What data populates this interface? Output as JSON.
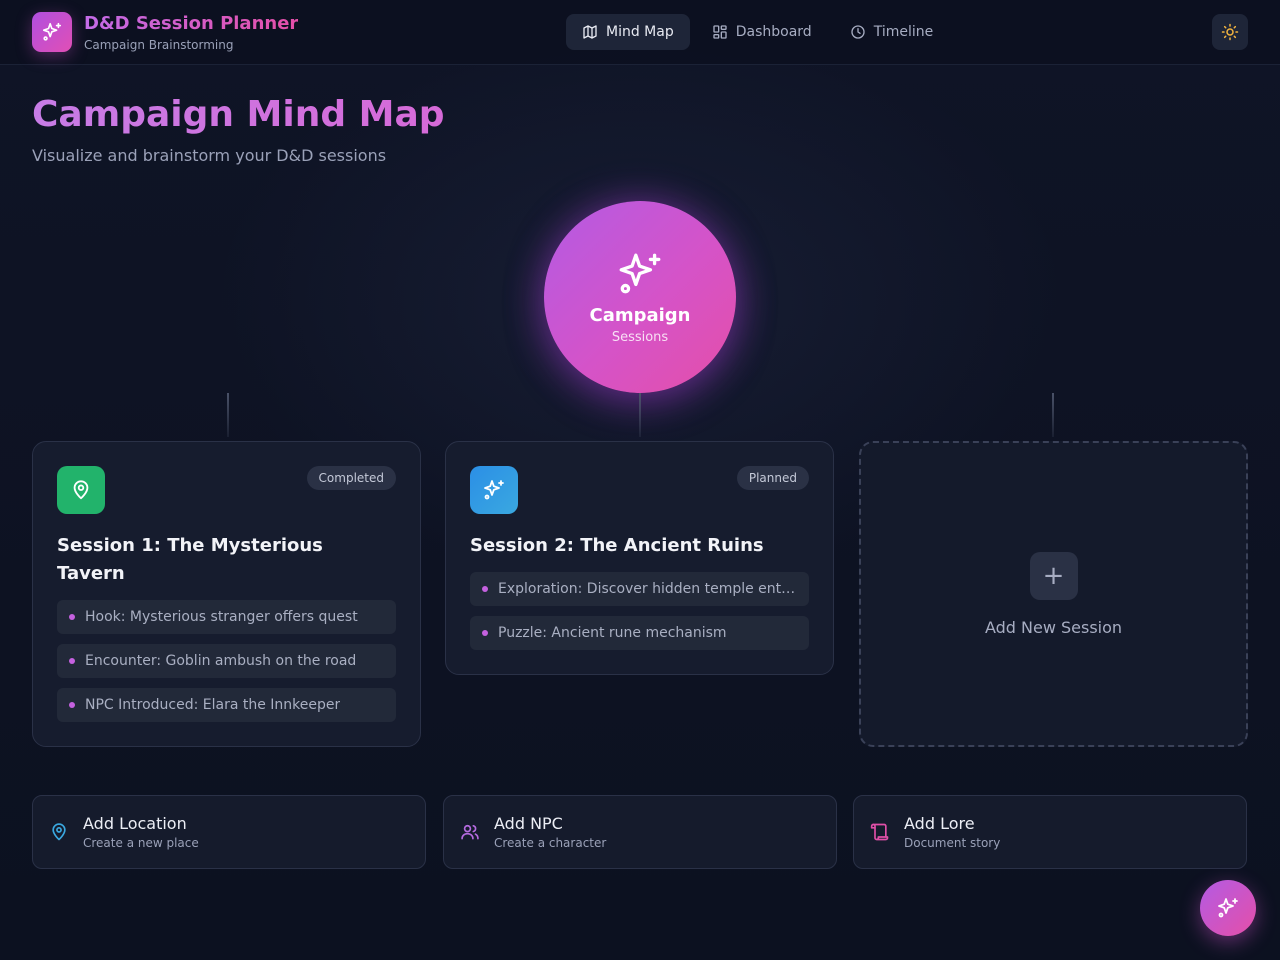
{
  "app": {
    "title": "D&D Session Planner",
    "subtitle": "Campaign Brainstorming",
    "logo_icon": "sparkles-icon"
  },
  "nav": {
    "items": [
      {
        "label": "Mind Map",
        "icon": "map-icon",
        "active": true
      },
      {
        "label": "Dashboard",
        "icon": "dashboard-icon",
        "active": false
      },
      {
        "label": "Timeline",
        "icon": "clock-icon",
        "active": false
      }
    ],
    "theme_toggle_icon": "sun-icon"
  },
  "page": {
    "title": "Campaign Mind Map",
    "subtitle": "Visualize and brainstorm your D&D sessions"
  },
  "center_node": {
    "title": "Campaign",
    "subtitle": "Sessions",
    "icon": "sparkles-icon"
  },
  "sessions": [
    {
      "title": "Session 1: The Mysterious Tavern",
      "status": "Completed",
      "icon": "map-pin-icon",
      "icon_color": "#22b36b",
      "events": [
        "Hook: Mysterious stranger offers quest",
        "Encounter: Goblin ambush on the road",
        "NPC Introduced: Elara the Innkeeper"
      ]
    },
    {
      "title": "Session 2: The Ancient Ruins",
      "status": "Planned",
      "icon": "sparkles-icon",
      "icon_color": "#2b8fe6",
      "events": [
        "Exploration: Discover hidden temple entrance",
        "Puzzle: Ancient rune mechanism"
      ]
    }
  ],
  "add_session": {
    "label": "Add New Session",
    "icon": "plus-icon"
  },
  "quick_actions": [
    {
      "title": "Add Location",
      "subtitle": "Create a new place",
      "icon": "map-pin-icon",
      "color": "#3aa8e0"
    },
    {
      "title": "Add NPC",
      "subtitle": "Create a character",
      "icon": "users-icon",
      "color": "#b56be0"
    },
    {
      "title": "Add Lore",
      "subtitle": "Document story",
      "icon": "scroll-icon",
      "color": "#e04fa8"
    }
  ],
  "fab": {
    "icon": "sparkles-icon"
  },
  "colors": {
    "accent_purple": "#b35be4",
    "accent_pink": "#e54fa8",
    "background": "#0d1222"
  }
}
